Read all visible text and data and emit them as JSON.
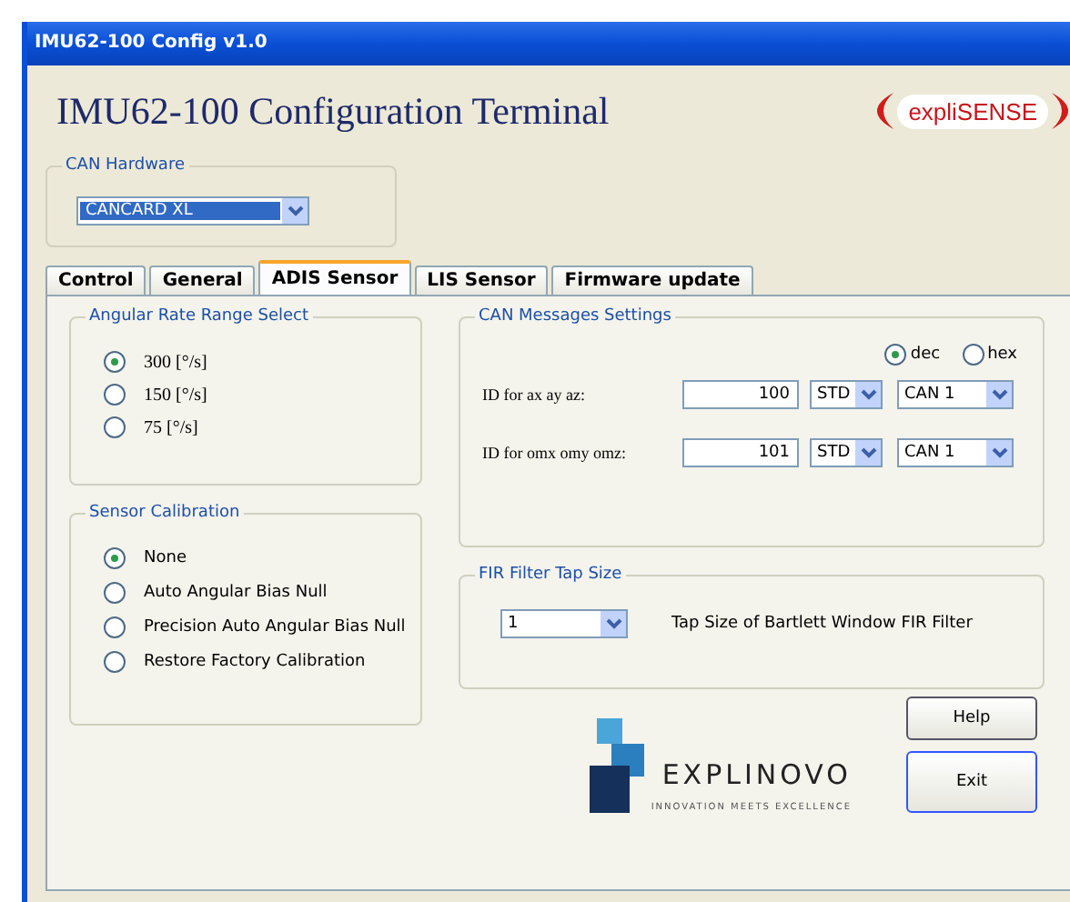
{
  "window": {
    "title": "IMU62-100 Config v1.0"
  },
  "heading": "IMU62-100 Configuration Terminal",
  "brand_logo": "expliSENSE",
  "can_hardware": {
    "label": "CAN Hardware",
    "value": "CANCARD XL"
  },
  "tabs": [
    {
      "label": "Control",
      "selected": false
    },
    {
      "label": "General",
      "selected": false
    },
    {
      "label": "ADIS Sensor",
      "selected": true
    },
    {
      "label": "LIS Sensor",
      "selected": false
    },
    {
      "label": "Firmware update",
      "selected": false
    }
  ],
  "angular_rate": {
    "label": "Angular Rate Range Select",
    "options": [
      {
        "label": "300 [°/s]",
        "selected": true
      },
      {
        "label": "150 [°/s]",
        "selected": false
      },
      {
        "label": "75 [°/s]",
        "selected": false
      }
    ]
  },
  "sensor_calibration": {
    "label": "Sensor Calibration",
    "options": [
      {
        "label": "None",
        "selected": true
      },
      {
        "label": "Auto Angular Bias Null",
        "selected": false
      },
      {
        "label": "Precision Auto Angular Bias Null",
        "selected": false
      },
      {
        "label": "Restore Factory Calibration",
        "selected": false
      }
    ]
  },
  "can_messages": {
    "label": "CAN Messages Settings",
    "format": [
      {
        "label": "dec",
        "selected": true
      },
      {
        "label": "hex",
        "selected": false
      }
    ],
    "rows": [
      {
        "label": "ID for ax ay az:",
        "id": "100",
        "frame": "STD",
        "channel": "CAN 1"
      },
      {
        "label": "ID for omx omy omz:",
        "id": "101",
        "frame": "STD",
        "channel": "CAN 1"
      }
    ]
  },
  "fir_filter": {
    "label": "FIR Filter Tap Size",
    "value": "1",
    "description": "Tap Size of Bartlett Window FIR Filter"
  },
  "company_logo": {
    "name": "EXPLINOVO",
    "tagline": "INNOVATION MEETS EXCELLENCE"
  },
  "buttons": [
    "Help",
    "Exit"
  ]
}
